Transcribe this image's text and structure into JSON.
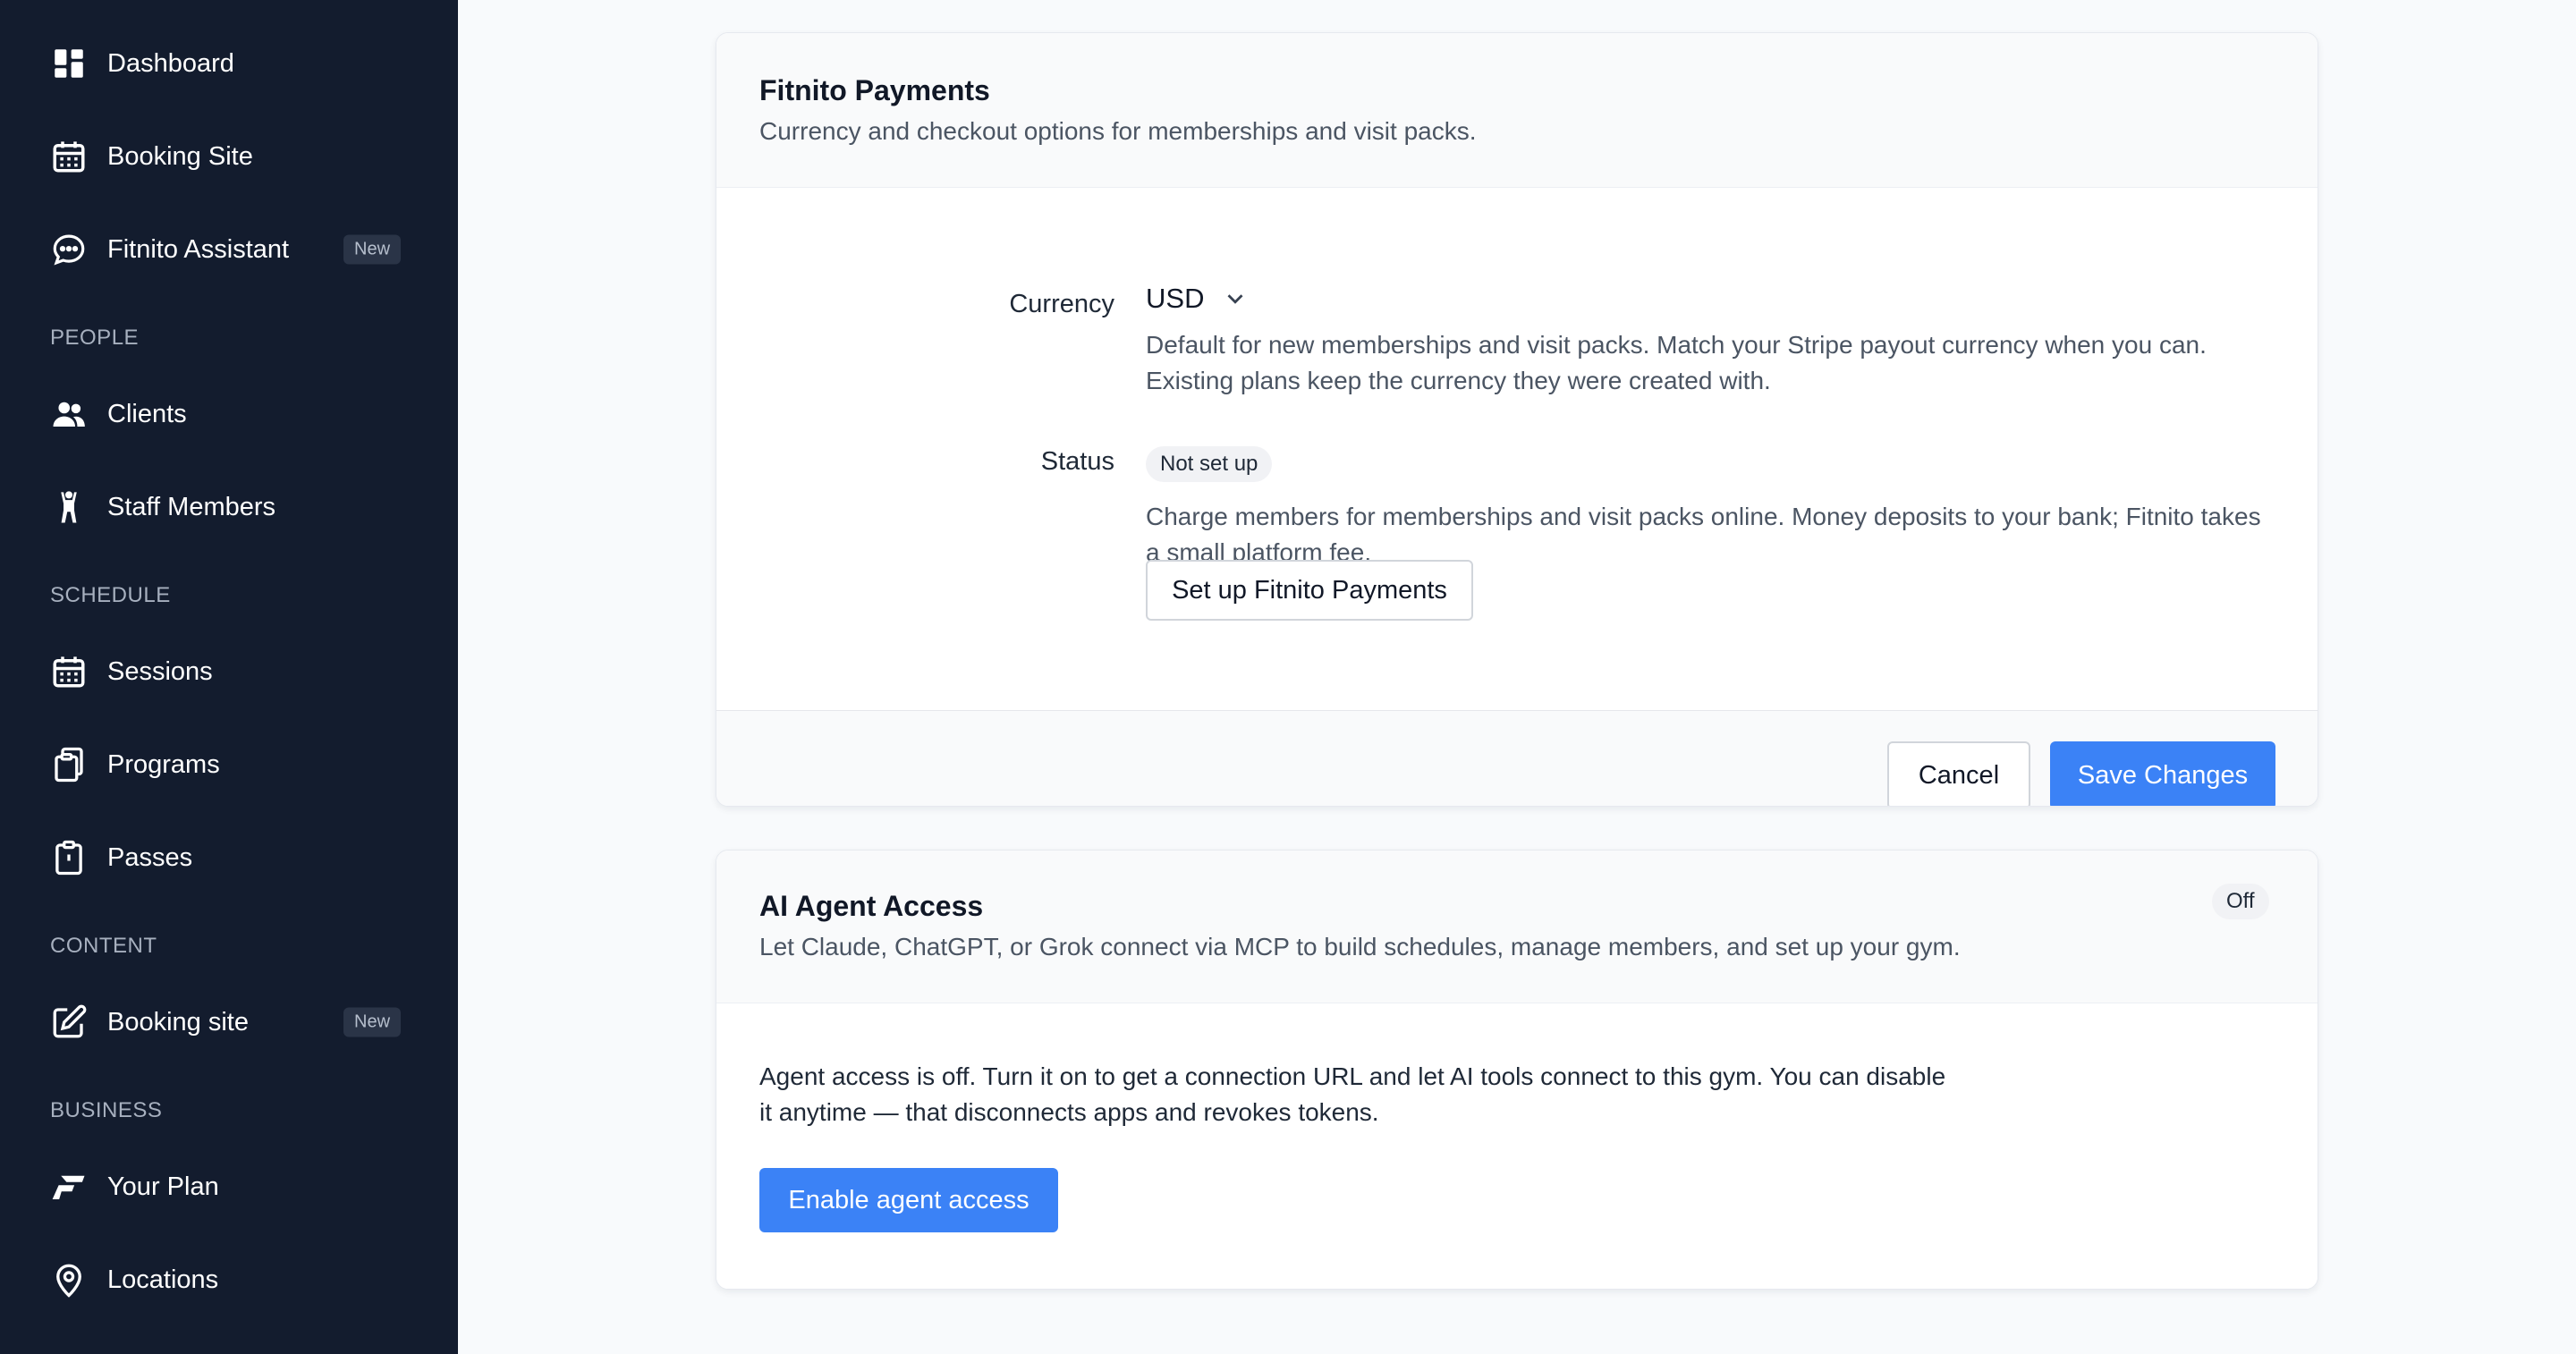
{
  "sidebar": {
    "items": [
      {
        "label": "Dashboard",
        "icon": "dashboard-icon"
      },
      {
        "label": "Booking Site",
        "icon": "calendar-icon"
      },
      {
        "label": "Fitnito Assistant",
        "icon": "chat-bubble-icon",
        "badge": "New"
      },
      {
        "label": "Clients",
        "icon": "users-icon"
      },
      {
        "label": "Staff Members",
        "icon": "person-icon"
      },
      {
        "label": "Sessions",
        "icon": "calendar-icon"
      },
      {
        "label": "Programs",
        "icon": "clipboard-copy-icon"
      },
      {
        "label": "Passes",
        "icon": "clipboard-icon"
      },
      {
        "label": "Booking site",
        "icon": "edit-icon",
        "badge": "New"
      },
      {
        "label": "Your Plan",
        "icon": "fitnito-logo-icon"
      },
      {
        "label": "Locations",
        "icon": "map-pin-icon"
      }
    ],
    "sections": {
      "people": "PEOPLE",
      "schedule": "SCHEDULE",
      "content": "CONTENT",
      "business": "BUSINESS"
    }
  },
  "payments": {
    "title": "Fitnito Payments",
    "subtitle": "Currency and checkout options for memberships and visit packs.",
    "currency_label": "Currency",
    "currency_value": "USD",
    "currency_help": "Default for new memberships and visit packs. Match your Stripe payout currency when you can. Existing plans keep the currency they were created with.",
    "status_label": "Status",
    "status_value": "Not set up",
    "status_help": "Charge members for memberships and visit packs online. Money deposits to your bank; Fitnito takes a small platform fee.",
    "setup_button": "Set up Fitnito Payments",
    "cancel_button": "Cancel",
    "save_button": "Save Changes"
  },
  "agent": {
    "title": "AI Agent Access",
    "subtitle": "Let Claude, ChatGPT, or Grok connect via MCP to build schedules, manage members, and set up your gym.",
    "status_badge": "Off",
    "body": "Agent access is off. Turn it on to get a connection URL and let AI tools connect to this gym. You can disable it anytime — that disconnects apps and revokes tokens.",
    "enable_button": "Enable agent access"
  },
  "colors": {
    "sidebar_bg": "#131c2e",
    "primary": "#3b82f6",
    "page_bg": "#f8fafc"
  }
}
